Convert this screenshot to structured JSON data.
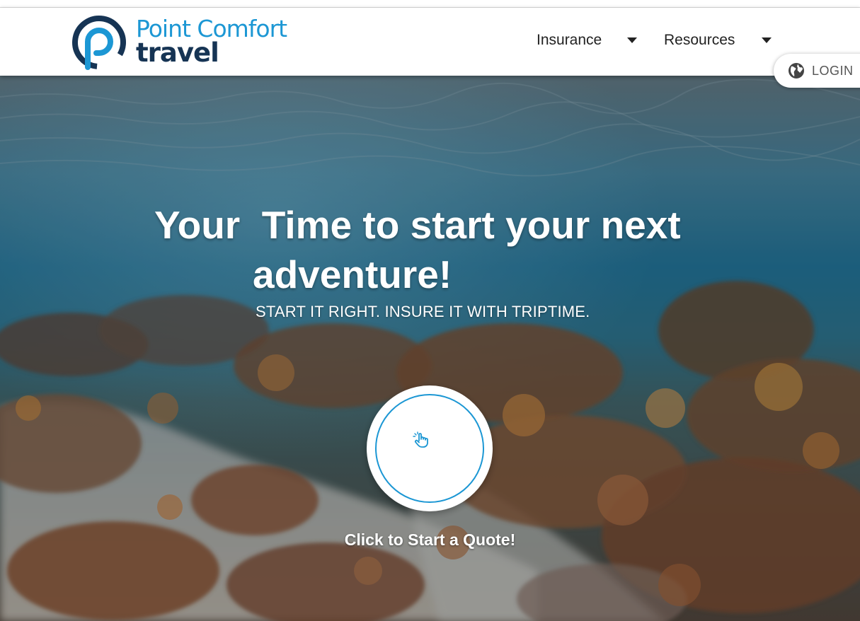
{
  "brand": {
    "name_line1": "Point Comfort",
    "name_line2": "travel",
    "colors": {
      "primary": "#1c97d4",
      "dark": "#163454"
    },
    "logo_icon": "p-logo-icon"
  },
  "nav": {
    "items": [
      {
        "label": "Insurance",
        "icon": "caret-down-icon"
      },
      {
        "label": "Resources",
        "icon": "caret-down-icon"
      }
    ]
  },
  "login": {
    "label": "LOGIN",
    "icon": "globe-icon"
  },
  "hero": {
    "headline_line1": "Your  Time to start your next",
    "headline_line2": "adventure!",
    "subheadline": "START IT RIGHT. INSURE IT WITH TRIPTIME.",
    "cta_icon": "pointer-hand-icon",
    "cta_caption": "Click to Start a Quote!",
    "background": "underwater-coral-reef-photo"
  }
}
